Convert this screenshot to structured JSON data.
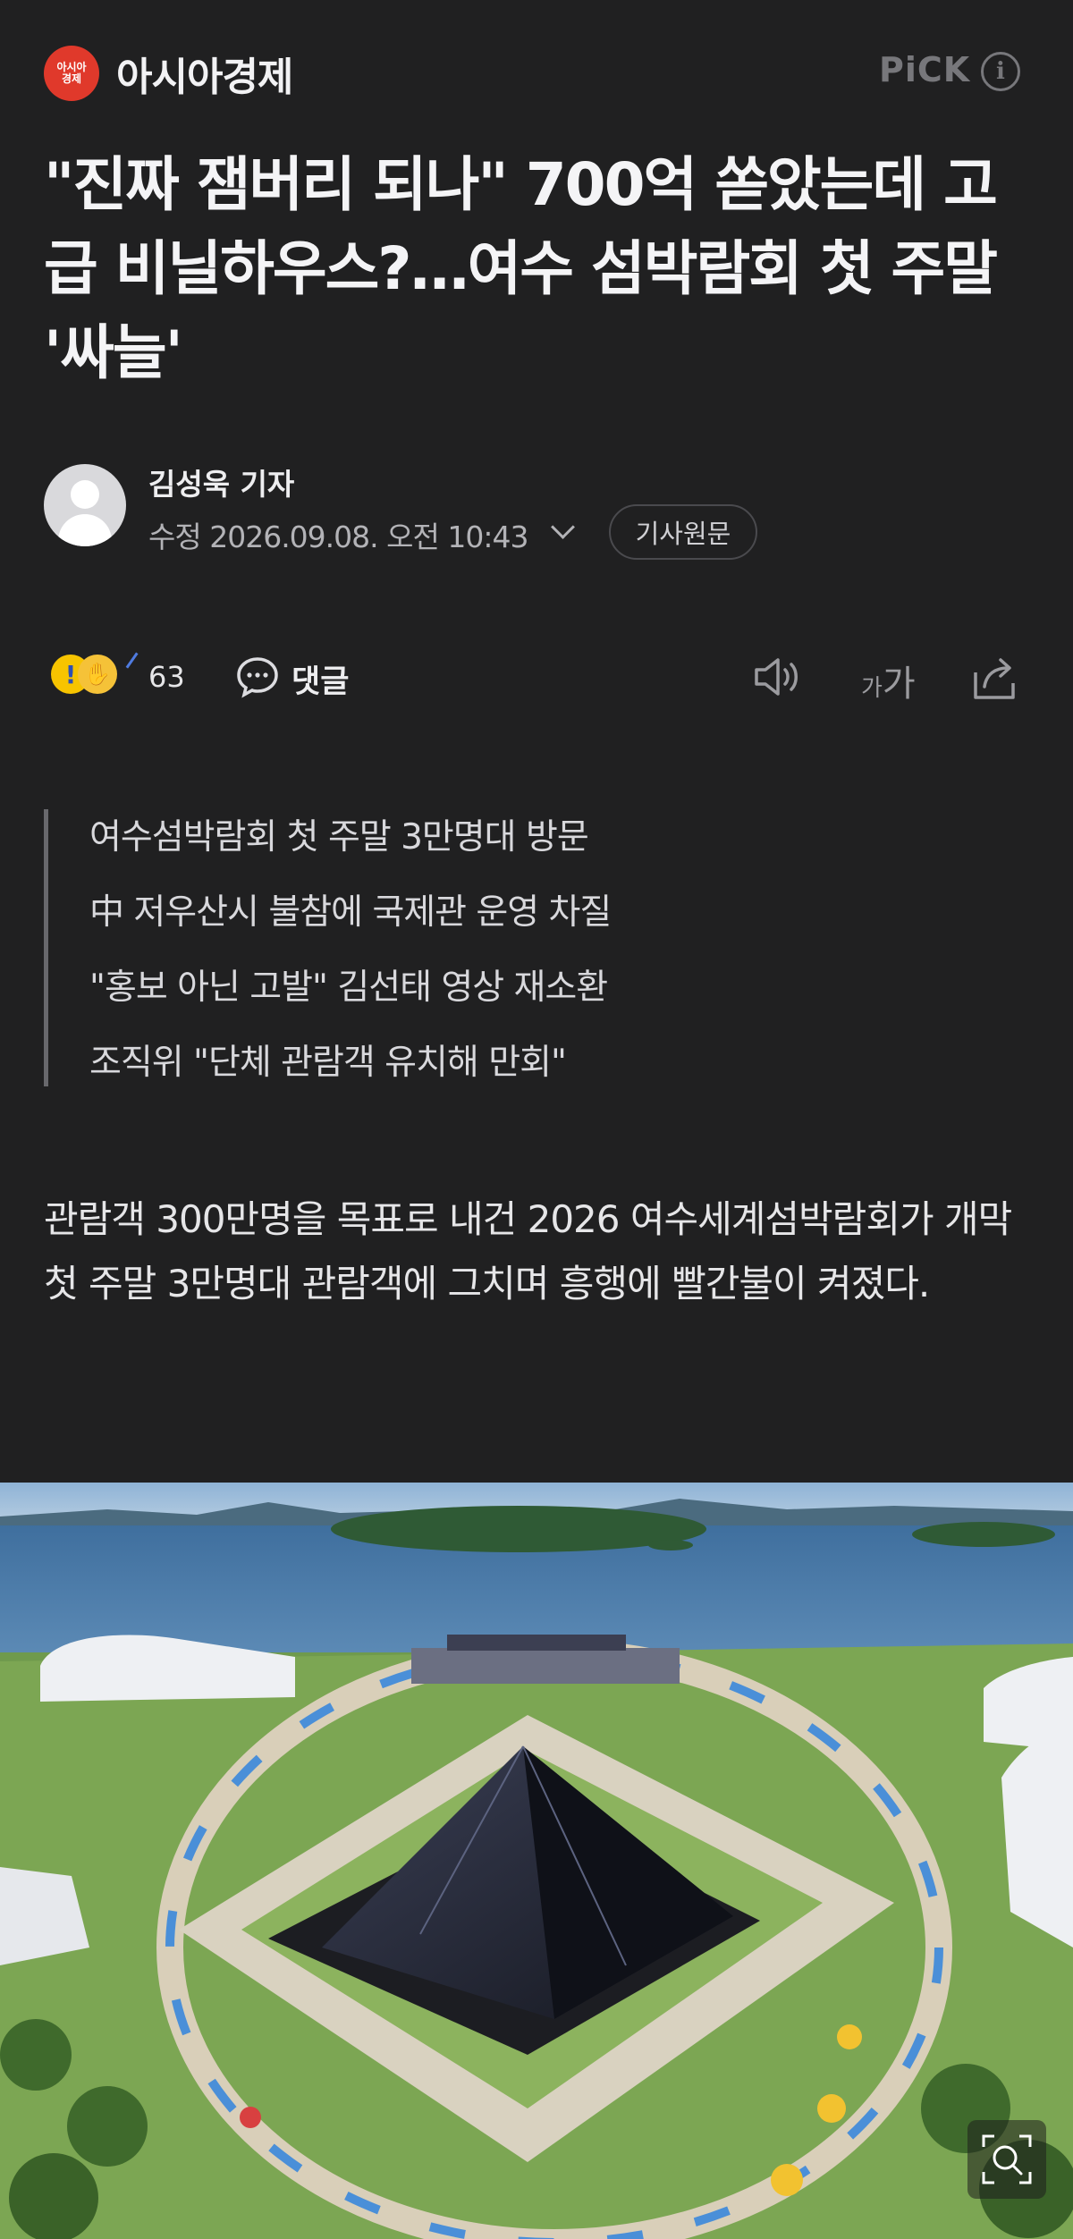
{
  "header": {
    "press_logo_text_line1": "아시아",
    "press_logo_text_line2": "경제",
    "press_name": "아시아경제",
    "pick_label": "PiCK",
    "info_icon": "info-icon"
  },
  "article": {
    "headline": "\"진짜 잼버리 되나\" 700억 쏟았는데 고급 비닐하우스?…여수 섬박람회 첫 주말 '싸늘'",
    "reporter": "김성욱 기자",
    "date": "수정 2026.09.08. 오전 10:43",
    "original_button": "기사원문",
    "summary": [
      "여수섬박람회 첫 주말 3만명대 방문",
      "中 저우산시 불참에 국제관 운영 차질",
      "\"홍보 아닌 고발\" 김선태 영상 재소환",
      "조직위 \"단체 관람객 유치해 만회\""
    ],
    "body": "관람객 300만명을 목표로 내건 2026 여수세계섬박람회가 개막 첫 주말 3만명대 관람객에 그치며 흥행에 빨간불이 켜졌다."
  },
  "actions": {
    "reaction_count": "63",
    "comment_label": "댓글",
    "font_size_label_small": "가",
    "font_size_label_large": "가",
    "icons": [
      "reaction-emoji-icon",
      "comment-icon",
      "tts-speaker-icon",
      "font-size-icon",
      "share-icon"
    ]
  },
  "photo": {
    "zoom_icon": "zoom-icon"
  },
  "colors": {
    "background": "#202021",
    "logo_red": "#e0392b",
    "muted": "#77777b"
  }
}
